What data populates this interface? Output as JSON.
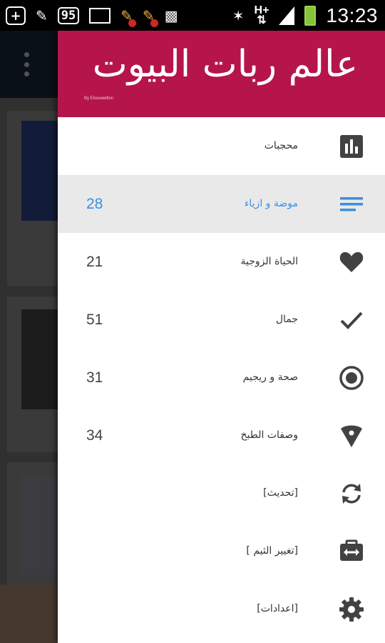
{
  "status_bar": {
    "time": "13:23",
    "network": "H+",
    "notification_count": "95",
    "icons": [
      "add-icon",
      "broom-icon",
      "notification-95-icon",
      "mail-icon",
      "cleaner-icon",
      "cleaner-icon",
      "popcorn-icon",
      "bluetooth-icon",
      "network-h-plus-icon",
      "signal-icon",
      "battery-charging-icon"
    ]
  },
  "drawer": {
    "title": "عالم ربات البيوت",
    "subtitle": "By Elsouwetlon",
    "items": [
      {
        "label": "محجبات",
        "count": "",
        "icon": "bar-chart-icon",
        "active": false
      },
      {
        "label": "موضة و ازياء",
        "count": "28",
        "icon": "lines-icon",
        "active": true
      },
      {
        "label": "الحياة الزوجية",
        "count": "21",
        "icon": "heart-icon",
        "active": false
      },
      {
        "label": "جمال",
        "count": "51",
        "icon": "check-icon",
        "active": false
      },
      {
        "label": "صحة و ريجيم",
        "count": "31",
        "icon": "radio-button-icon",
        "active": false
      },
      {
        "label": "وصفات الطبخ",
        "count": "34",
        "icon": "location-pin-icon",
        "active": false
      },
      {
        "label": "[تحديث]",
        "count": "",
        "icon": "refresh-icon",
        "active": false
      },
      {
        "label": "[تغيير الثيم ]",
        "count": "",
        "icon": "theme-icon",
        "active": false
      },
      {
        "label": "[اعدادات]",
        "count": "",
        "icon": "settings-icon",
        "active": false
      }
    ]
  },
  "colors": {
    "header": "#b5154b",
    "active_accent": "#3a8fe0",
    "active_bg": "#e9e9e9",
    "icon": "#424242"
  }
}
